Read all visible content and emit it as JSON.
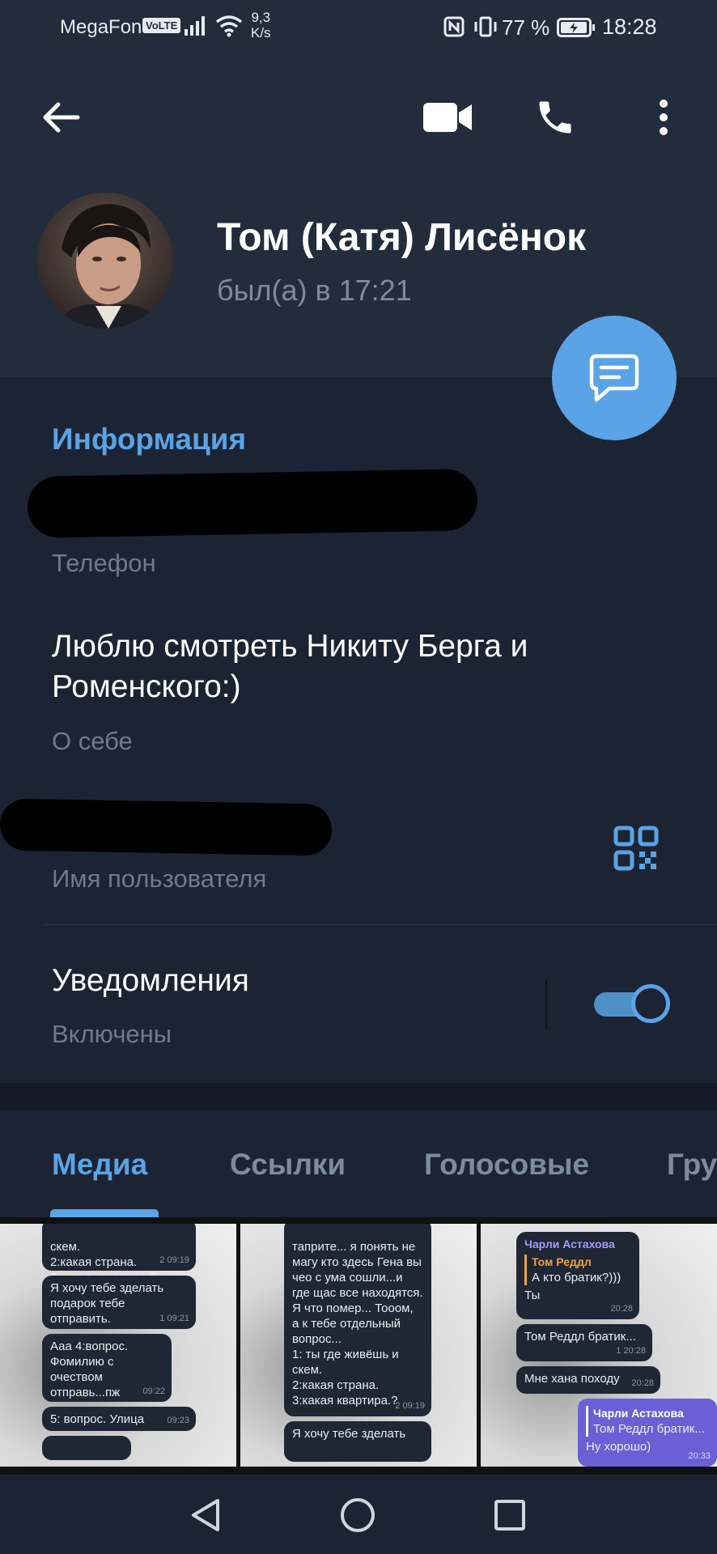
{
  "status_bar": {
    "carrier": "MegaFon",
    "volte": "VoLTE",
    "speed_value": "9,3",
    "speed_unit": "K/s",
    "battery_percent": "77 %",
    "time": "18:28"
  },
  "header": {
    "contact_name": "Том (Катя) Лисёнок",
    "last_seen": "был(а) в 17:21"
  },
  "info": {
    "section_title": "Информация",
    "phone_label": "Телефон",
    "bio_value": "Люблю смотреть Никиту Берга и Роменского:)",
    "bio_label": "О себе",
    "username_label": "Имя пользователя",
    "notifications_title": "Уведомления",
    "notifications_status": "Включены",
    "notifications_enabled": true
  },
  "tabs": [
    {
      "label": "Медиа",
      "active": true
    },
    {
      "label": "Ссылки",
      "active": false
    },
    {
      "label": "Голосовые",
      "active": false
    },
    {
      "label": "Гру",
      "active": false
    }
  ],
  "media": {
    "thumb1": {
      "b1": "скем.\n2:какая страна.\n3:какая квартира.?",
      "b1_time": "2 09:19",
      "b2": "Я хочу тебе зделать подарок тебе отправить.",
      "b2_time": "1 09:21",
      "b3": "Ааа 4:вопрос. Фомилию с очеством отправь...пж",
      "b3_time": "09:22",
      "b4": "5: вопрос. Улица",
      "b4_time": "09:23"
    },
    "thumb2": {
      "b1": "таприте... я понять не магу кто здесь Гена вы чео с ума сошли...и где щас все находятся. Я что помер... Тооом, а к тебе отдельный вопрос...\n1: ты где живёшь и скем.\n2:какая страна.\n3:какая квартира.?",
      "b1_time": "2 09:19",
      "b2": "Я хочу тебе зделать"
    },
    "thumb3": {
      "sender": "Чарли Астахова",
      "quote_name": "Том Реддл",
      "quote_text": "А кто братик?)))",
      "b1_text": "Ты",
      "b1_time": "20:28",
      "b2": "Том Реддл братик...",
      "b2_time": "1 20:28",
      "b3": "Мне хана походу",
      "b3_time": "20:28",
      "out_quote_name": "Чарли Астахова",
      "out_quote_text": "Том Реддл братик...",
      "out_text": "Ну хорошо)",
      "out_time": "20:33"
    }
  },
  "icons": {
    "back": "arrow-left-icon",
    "video": "video-camera-icon",
    "call": "phone-icon",
    "more": "more-vertical-icon",
    "message": "message-icon",
    "qr": "qr-code-icon"
  },
  "colors": {
    "accent": "#5aa3e6",
    "background": "#1c2433",
    "header": "#232c3b"
  }
}
